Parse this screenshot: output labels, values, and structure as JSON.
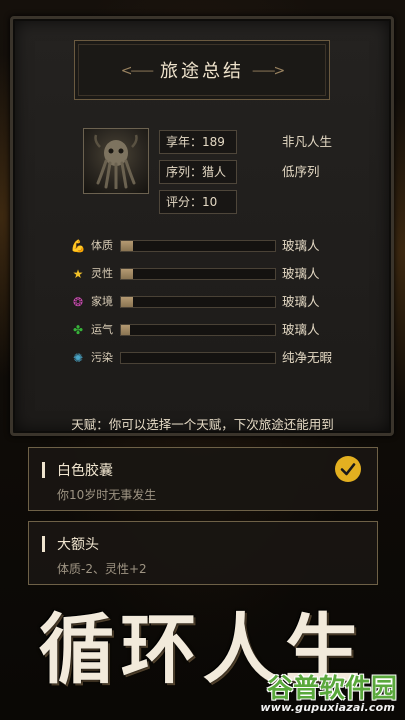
{
  "header": {
    "title": "旅途总结",
    "flourish_left": "<⸺",
    "flourish_right": "⸺>"
  },
  "profile": {
    "avatar_icon": "tentacle-portrait-icon",
    "age": "享年：189",
    "sequence": "序列：猎人",
    "score": "评分：10",
    "life_rating": "非凡人生",
    "sequence_rating": "低序列"
  },
  "stats": [
    {
      "icon": "muscle-icon",
      "color": "#e25a2c",
      "label": "体质",
      "fill": 0.08,
      "value": "玻璃人"
    },
    {
      "icon": "star-icon",
      "color": "#f2c229",
      "label": "灵性",
      "fill": 0.08,
      "value": "玻璃人"
    },
    {
      "icon": "brain-icon",
      "color": "#c94ab0",
      "label": "家境",
      "fill": 0.08,
      "value": "玻璃人"
    },
    {
      "icon": "clover-icon",
      "color": "#37b23a",
      "label": "运气",
      "fill": 0.06,
      "value": "玻璃人"
    },
    {
      "icon": "virus-icon",
      "color": "#4aa6c8",
      "label": "污染",
      "fill": 0.0,
      "value": "纯净无暇"
    }
  ],
  "talent": {
    "hint": "天赋：你可以选择一个天赋，下次旅途还能用到",
    "cards": [
      {
        "name": "白色胶囊",
        "desc": "你10岁时无事发生",
        "selected": true
      },
      {
        "name": "大额头",
        "desc": "体质-2、灵性+2",
        "selected": false
      }
    ]
  },
  "banner": {
    "text": "循环人生"
  },
  "watermark": {
    "cn": "谷普软件园",
    "url": "www.gupuxiazai.com"
  },
  "colors": {
    "accent_gold": "#e3b020",
    "frame": "#6e6147"
  }
}
